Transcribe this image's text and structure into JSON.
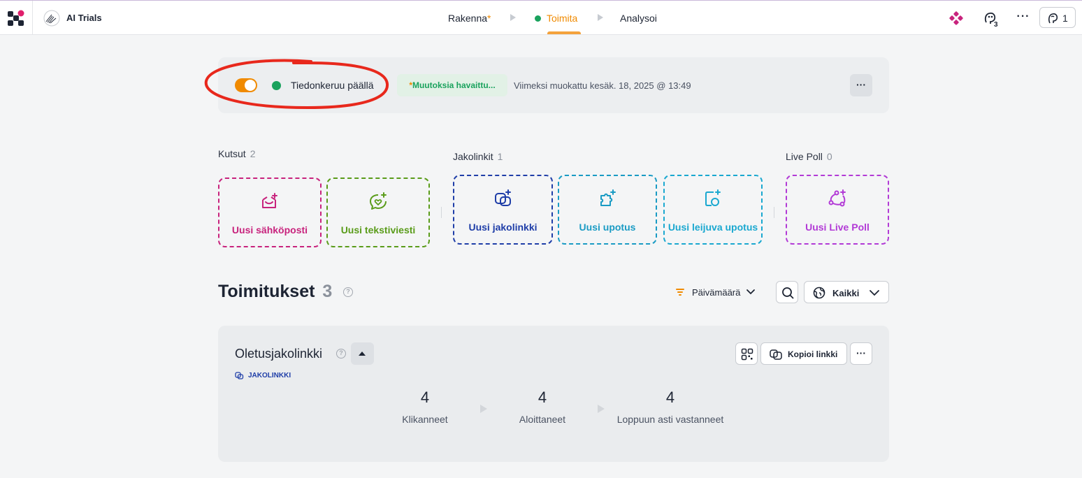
{
  "header": {
    "project_name": "AI Trials",
    "steps": [
      {
        "label": "Rakenna",
        "marker": "*"
      },
      {
        "label": "Toimita",
        "active": true
      },
      {
        "label": "Analysoi"
      }
    ],
    "collaborators_count": "3",
    "more_label": "···",
    "user_count": "1"
  },
  "status": {
    "collection_label": "Tiedonkeruu päällä",
    "changes_marker": "*",
    "changes_label": "Muutoksia havaittu...",
    "last_edited": "Viimeksi muokattu kesäk. 18, 2025 @ 13:49",
    "more_label": "···",
    "toggle_on": true
  },
  "sections": {
    "invites": {
      "title": "Kutsut",
      "count": "2"
    },
    "share_links": {
      "title": "Jakolinkit",
      "count": "1"
    },
    "live_poll": {
      "title": "Live Poll",
      "count": "0"
    }
  },
  "tiles": {
    "email": "Uusi sähköposti",
    "sms": "Uusi tekstiviesti",
    "share_link": "Uusi jakolinkki",
    "embed": "Uusi upotus",
    "floating_embed": "Uusi leijuva upotus",
    "live_poll": "Uusi Live Poll"
  },
  "deliveries": {
    "title": "Toimitukset",
    "count": "3",
    "sort_label": "Päivämäärä",
    "filter_label": "Kaikki"
  },
  "delivery_card": {
    "name": "Oletusjakolinkki",
    "type_label": "JAKOLINKKI",
    "copy_label": "Kopioi linkki",
    "more_label": "···",
    "stats": [
      {
        "value": "4",
        "label": "Klikanneet"
      },
      {
        "value": "4",
        "label": "Aloittaneet"
      },
      {
        "value": "4",
        "label": "Loppuun asti vastanneet"
      }
    ]
  },
  "colors": {
    "accent_orange": "#f08a00",
    "live_green": "#1aa25d",
    "email_magenta": "#c8237d",
    "sms_green": "#5a9c1a",
    "link_blue": "#1f3ea8",
    "embed_cyan": "#1a9bc4",
    "poll_purple": "#b23ad6",
    "annotation_red": "#e8281c"
  }
}
